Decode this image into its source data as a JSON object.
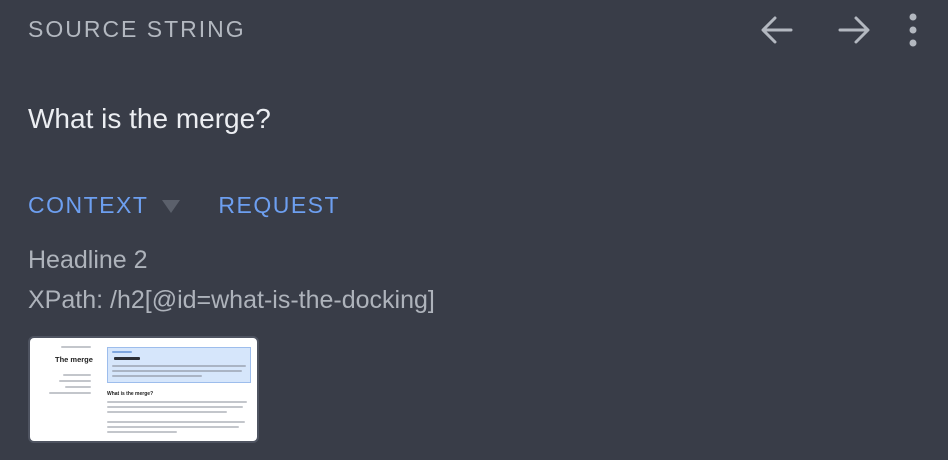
{
  "header": {
    "title": "SOURCE STRING",
    "back_icon": "arrow-left-icon",
    "forward_icon": "arrow-right-icon",
    "menu_icon": "more-vert-icon"
  },
  "source_string": "What is the merge?",
  "tabs": [
    {
      "label": "CONTEXT",
      "has_dropdown": true
    },
    {
      "label": "REQUEST",
      "has_dropdown": false
    }
  ],
  "context": {
    "element": "Headline 2",
    "xpath": "XPath: /h2[@id=what-is-the-docking]"
  },
  "screenshot_thumbnail": {
    "page_title": "The merge",
    "heading": "What is the merge?"
  },
  "colors": {
    "background": "#393d48",
    "accent": "#6d9ff0",
    "primary_text": "#eceef2",
    "secondary_text": "#aeb3bb"
  }
}
